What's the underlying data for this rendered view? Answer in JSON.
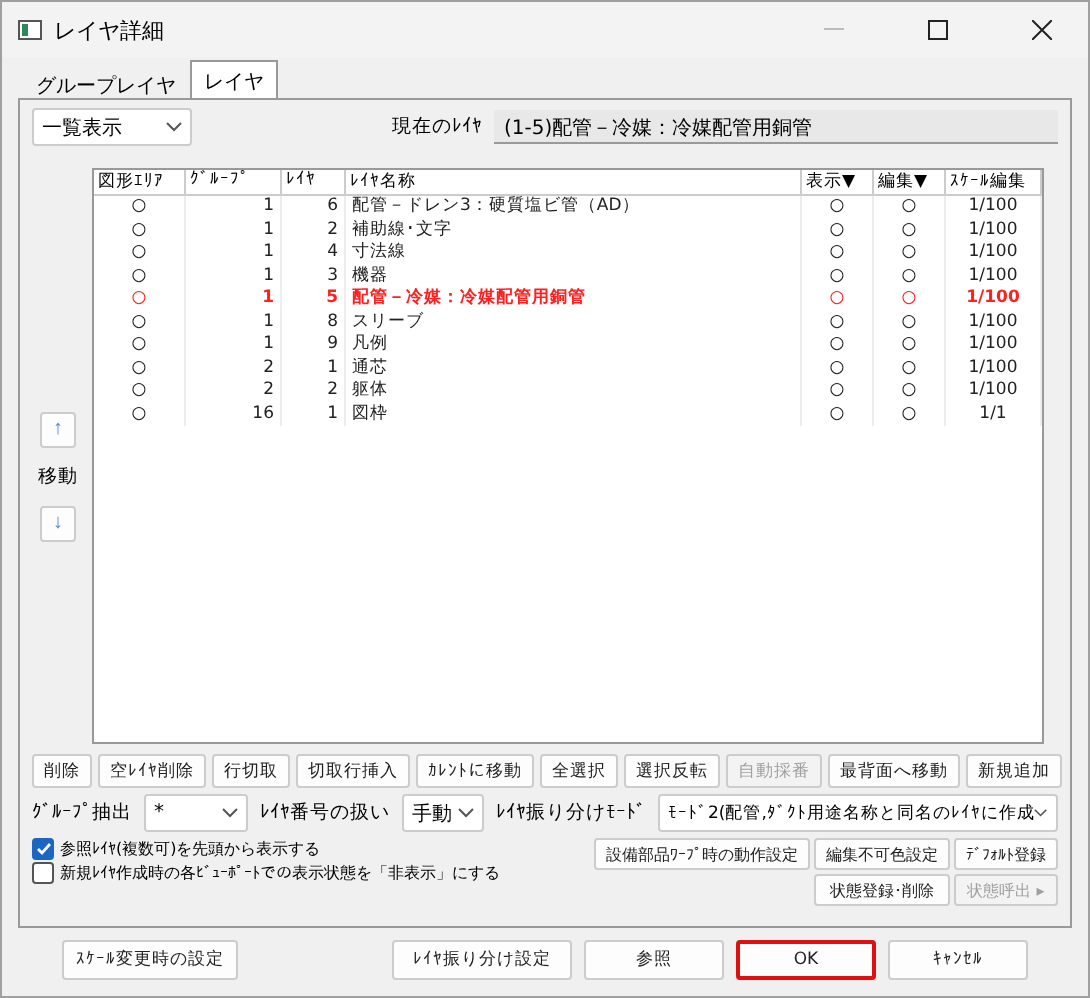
{
  "window": {
    "title": "レイヤ詳細"
  },
  "tabs": [
    {
      "label": "グループレイヤ",
      "selected": false
    },
    {
      "label": "レイヤ",
      "selected": true
    }
  ],
  "view_select": {
    "value": "一覧表示"
  },
  "current_layer": {
    "label": "現在のﾚｲﾔ",
    "value": "(1-5)配管－冷媒：冷媒配管用銅管"
  },
  "move": {
    "up": "↑",
    "label": "移動",
    "down": "↓"
  },
  "table": {
    "columns": [
      "図形ｴﾘｱ",
      "ｸﾞﾙｰﾌﾟ",
      "ﾚｲﾔ",
      "ﾚｲﾔ名称",
      "表示▼",
      "編集▼",
      "ｽｹｰﾙ編集"
    ],
    "rows": [
      {
        "area": "○",
        "group": "1",
        "layer": "6",
        "name": "配管－ドレン3：硬質塩ビ管（AD）",
        "display": "○",
        "edit": "○",
        "scale": "1/100",
        "current": false
      },
      {
        "area": "○",
        "group": "1",
        "layer": "2",
        "name": "補助線･文字",
        "display": "○",
        "edit": "○",
        "scale": "1/100",
        "current": false
      },
      {
        "area": "○",
        "group": "1",
        "layer": "4",
        "name": "寸法線",
        "display": "○",
        "edit": "○",
        "scale": "1/100",
        "current": false
      },
      {
        "area": "○",
        "group": "1",
        "layer": "3",
        "name": "機器",
        "display": "○",
        "edit": "○",
        "scale": "1/100",
        "current": false
      },
      {
        "area": "○",
        "group": "1",
        "layer": "5",
        "name": "配管－冷媒：冷媒配管用銅管",
        "display": "○",
        "edit": "○",
        "scale": "1/100",
        "current": true
      },
      {
        "area": "○",
        "group": "1",
        "layer": "8",
        "name": "スリーブ",
        "display": "○",
        "edit": "○",
        "scale": "1/100",
        "current": false
      },
      {
        "area": "○",
        "group": "1",
        "layer": "9",
        "name": "凡例",
        "display": "○",
        "edit": "○",
        "scale": "1/100",
        "current": false
      },
      {
        "area": "○",
        "group": "2",
        "layer": "1",
        "name": "通芯",
        "display": "○",
        "edit": "○",
        "scale": "1/100",
        "current": false
      },
      {
        "area": "○",
        "group": "2",
        "layer": "2",
        "name": "躯体",
        "display": "○",
        "edit": "○",
        "scale": "1/100",
        "current": false
      },
      {
        "area": "○",
        "group": "16",
        "layer": "1",
        "name": "図枠",
        "display": "○",
        "edit": "○",
        "scale": "1/1",
        "current": false
      }
    ]
  },
  "action_buttons": [
    {
      "label": "削除",
      "disabled": false
    },
    {
      "label": "空ﾚｲﾔ削除",
      "disabled": false
    },
    {
      "label": "行切取",
      "disabled": false
    },
    {
      "label": "切取行挿入",
      "disabled": false
    },
    {
      "label": "ｶﾚﾝﾄに移動",
      "disabled": false
    },
    {
      "label": "全選択",
      "disabled": false
    },
    {
      "label": "選択反転",
      "disabled": false
    },
    {
      "label": "自動採番",
      "disabled": true
    },
    {
      "label": "最背面へ移動",
      "disabled": false
    },
    {
      "label": "新規追加",
      "disabled": false
    }
  ],
  "group_filter": {
    "label": "ｸﾞﾙｰﾌﾟ抽出",
    "value": "*"
  },
  "layer_number": {
    "label": "ﾚｲﾔ番号の扱い",
    "value": "手動"
  },
  "sort_mode": {
    "label": "ﾚｲﾔ振り分けﾓｰﾄﾞ",
    "value": "ﾓｰﾄﾞ2(配管,ﾀﾞｸﾄ用途名称と同名のﾚｲﾔに作成"
  },
  "checkboxes": [
    {
      "label": "参照ﾚｲﾔ(複数可)を先頭から表示する",
      "checked": true
    },
    {
      "label": "新規ﾚｲﾔ作成時の各ﾋﾞｭｰﾎﾟｰﾄでの表示状態を「非表示」にする",
      "checked": false
    }
  ],
  "option_buttons": [
    {
      "label": "設備部品ﾜｰﾌﾟ時の動作設定",
      "disabled": false
    },
    {
      "label": "編集不可色設定",
      "disabled": false
    },
    {
      "label": "ﾃﾞﾌｫﾙﾄ登録",
      "disabled": false
    },
    {
      "label": "状態登録･削除",
      "disabled": false
    },
    {
      "label": "状態呼出 ▸",
      "disabled": true
    }
  ],
  "footer_buttons": [
    {
      "label": "ｽｹｰﾙ変更時の設定",
      "focused": false
    },
    {
      "label": "ﾚｲﾔ振り分け設定",
      "focused": false
    },
    {
      "label": "参照",
      "focused": false
    },
    {
      "label": "OK",
      "focused": true
    },
    {
      "label": "ｷｬﾝｾﾙ",
      "focused": false
    }
  ]
}
